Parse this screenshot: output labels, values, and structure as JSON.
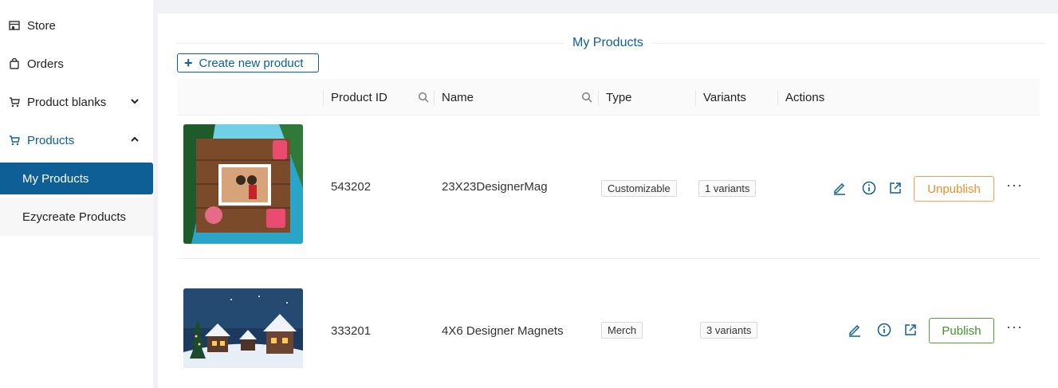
{
  "sidebar": {
    "items": [
      {
        "label": "Store",
        "icon": "store-icon"
      },
      {
        "label": "Orders",
        "icon": "bag-icon"
      },
      {
        "label": "Product blanks",
        "icon": "cart-icon"
      },
      {
        "label": "Products",
        "icon": "cart-icon"
      }
    ],
    "sub_items": [
      {
        "label": "My Products"
      },
      {
        "label": "Ezycreate Products"
      }
    ]
  },
  "main": {
    "title": "My Products",
    "create_label": "Create new product"
  },
  "table": {
    "columns": [
      "Product ID",
      "Name",
      "Type",
      "Variants",
      "Actions"
    ],
    "rows": [
      {
        "id": "543202",
        "name": "23X23DesignerMag",
        "type": "Customizable",
        "variants": "1 variants",
        "status_action": "Unpublish"
      },
      {
        "id": "333201",
        "name": "4X6 Designer Magnets",
        "type": "Merch",
        "variants": "3 variants",
        "status_action": "Publish"
      }
    ]
  },
  "colors": {
    "accent": "#0d5f96",
    "unpublish": "#e8912f",
    "publish": "#3f9426"
  },
  "more_glyph": "···"
}
